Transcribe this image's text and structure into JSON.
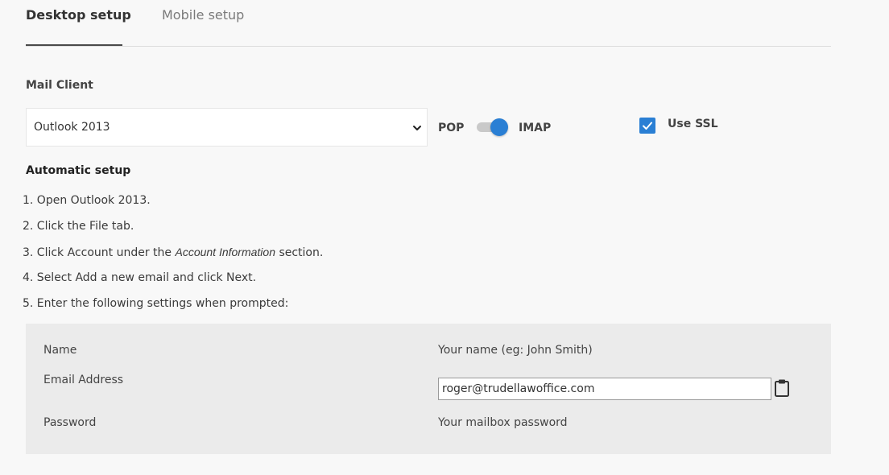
{
  "tabs": [
    {
      "label": "Desktop setup",
      "active": true
    },
    {
      "label": "Mobile setup",
      "active": false
    }
  ],
  "mail_client": {
    "label": "Mail Client",
    "selected": "Outlook 2013"
  },
  "protocol": {
    "left_label": "POP",
    "right_label": "IMAP",
    "selected": "IMAP"
  },
  "ssl": {
    "label": "Use SSL",
    "checked": true
  },
  "automatic_setup": {
    "heading": "Automatic setup",
    "steps": [
      {
        "prefix": "1. Open Outlook 2013.",
        "italic": "",
        "suffix": ""
      },
      {
        "prefix": "2. Click the File tab.",
        "italic": "",
        "suffix": ""
      },
      {
        "prefix": "3. Click Account under the ",
        "italic": "Account Information",
        "suffix": " section."
      },
      {
        "prefix": "4. Select Add a new email and click Next.",
        "italic": "",
        "suffix": ""
      },
      {
        "prefix": "5. Enter the following settings when prompted:",
        "italic": "",
        "suffix": ""
      }
    ]
  },
  "settings": {
    "name_label": "Name",
    "name_value": "Your name (eg: John Smith)",
    "email_label": "Email Address",
    "email_value": "roger@trudellawoffice.com",
    "password_label": "Password",
    "password_value": "Your mailbox password"
  },
  "colors": {
    "accent": "#2a7fd4",
    "panel": "#ebebeb"
  },
  "icons": {
    "select": "chevron-down-icon",
    "copy": "clipboard-icon",
    "check": "check-icon"
  }
}
